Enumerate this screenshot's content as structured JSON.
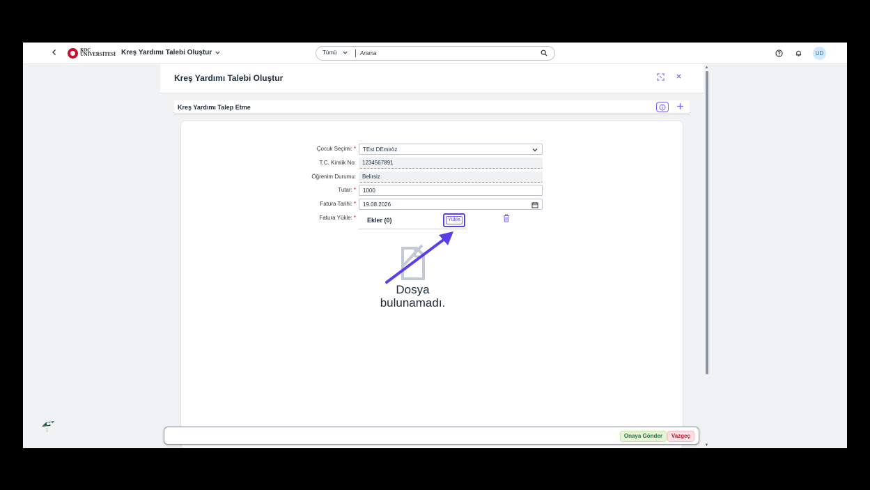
{
  "shell": {
    "logo_line1": "KOÇ",
    "logo_line2": "ÜNİVERSİTESİ",
    "app_title": "Kreş Yardımı Talebi Oluştur",
    "search_scope": "Tümü",
    "search_placeholder": "Arama",
    "avatar_initials": "UD"
  },
  "dialog": {
    "title": "Kreş Yardımı Talebi Oluştur",
    "section_title": "Kreş Yardımı Talep Etme",
    "form": {
      "child_label": "Çocuk Seçimi:",
      "child_value": "TEst DEmiröz",
      "tc_label": "T.C. Kimlik No:",
      "tc_value": "1234567891",
      "edu_label": "Öğrenim Durumu:",
      "edu_value": "Belirsiz",
      "amount_label": "Tutar:",
      "amount_value": "1000",
      "invoice_date_label": "Fatura Tarihi:",
      "invoice_date_value": "19.08.2026",
      "invoice_upload_label": "Fatura Yükle:",
      "required_mark": "*"
    },
    "attachments": {
      "title": "Ekler (0)",
      "upload_label": "Yükle",
      "empty_line1": "Dosya",
      "empty_line2": "bulunamadı."
    },
    "footer": {
      "approve_label": "Onaya Gönder",
      "cancel_label": "Vazgeç"
    }
  },
  "colors": {
    "accent": "#7b61ff",
    "annotation_arrow": "#5b3ee8",
    "approve_bg": "#e7f4d7",
    "cancel_bg": "#ffe0e5"
  }
}
